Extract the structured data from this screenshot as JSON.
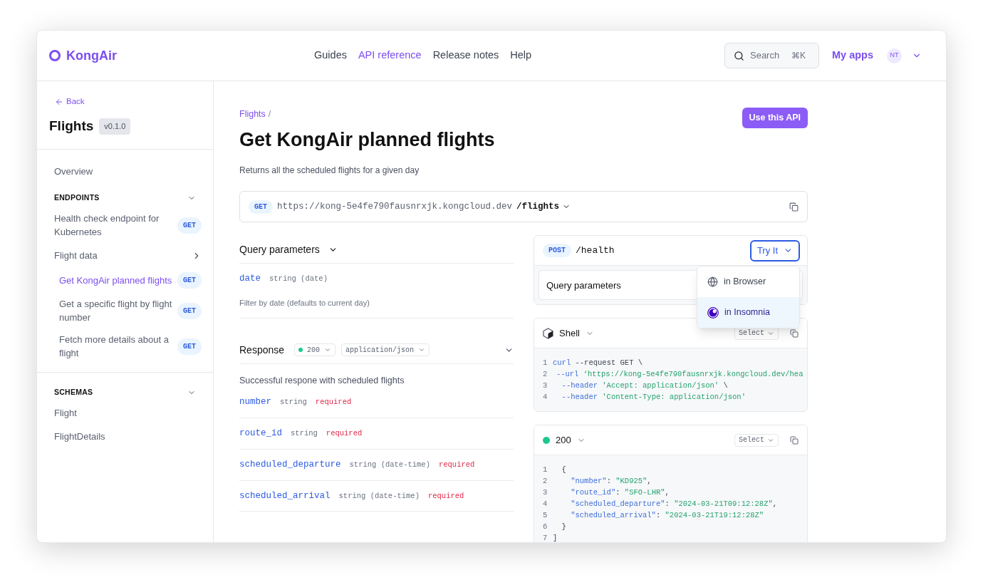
{
  "header": {
    "logo": "KongAir",
    "nav": [
      {
        "label": "Guides",
        "selected": false
      },
      {
        "label": "API reference",
        "selected": true
      },
      {
        "label": "Release notes",
        "selected": false
      },
      {
        "label": "Help",
        "selected": false
      }
    ],
    "search": {
      "placeholder": "Search",
      "shortcut": "⌘K"
    },
    "my_apps": "My apps",
    "avatar": "NT"
  },
  "sidebar": {
    "back": "Back",
    "title": "Flights",
    "version": "v0.1.0",
    "overview": {
      "label": "Overview",
      "selected": false
    },
    "sections": [
      {
        "title": "ENDPOINTS",
        "expanded": true,
        "items": [
          {
            "label": "Health check endpoint for Kubernetes",
            "method": "GET",
            "selected": false
          },
          {
            "label": "Flight data",
            "selected": false,
            "children": [
              {
                "label": "Get KongAir planned flights",
                "method": "GET",
                "selected": true
              },
              {
                "label": "Get a specific flight by flight number",
                "method": "GET",
                "selected": false
              },
              {
                "label": "Fetch more details about a flight",
                "method": "GET",
                "selected": false
              }
            ]
          }
        ]
      },
      {
        "title": "SCHEMAS",
        "expanded": true,
        "items": [
          {
            "label": "Flight",
            "selected": false
          },
          {
            "label": "FlightDetails",
            "selected": false
          }
        ]
      }
    ]
  },
  "main": {
    "breadcrumb": [
      "Flights",
      "/"
    ],
    "title": "Get KongAir planned flights",
    "use_button": "Use this API",
    "description": "Returns all the scheduled flights for a given day",
    "endpoint": {
      "method": "GET",
      "base": "https://kong-5e4fe790fausnrxjk.kongcloud.dev",
      "path": "/flights"
    },
    "query": {
      "title": "Query parameters",
      "expanded": true,
      "params": [
        {
          "name": "date",
          "type": "string (date)",
          "required": false,
          "description": "Filter by date (defaults to current day)"
        }
      ]
    },
    "response": {
      "title": "Response",
      "status": "200",
      "content_type": "application/json",
      "expanded": true,
      "description": "Successful respone with scheduled flights",
      "fields": [
        {
          "name": "number",
          "type": "string",
          "required": true,
          "required_label": "required"
        },
        {
          "name": "route_id",
          "type": "string",
          "required": true,
          "required_label": "required"
        },
        {
          "name": "scheduled_departure",
          "type": "string (date-time)",
          "required": true,
          "required_label": "required"
        },
        {
          "name": "scheduled_arrival",
          "type": "string (date-time)",
          "required": true,
          "required_label": "required"
        }
      ]
    }
  },
  "try_panel": {
    "method": "POST",
    "path": "/health",
    "try_button": "Try It",
    "menu_open": true,
    "query_title": "Query parameters",
    "menu": [
      {
        "label": "in Browser",
        "kind": "globe",
        "selected": false
      },
      {
        "label": "in Insomnia",
        "kind": "insomnia",
        "selected": true
      }
    ],
    "request": {
      "language": "Shell",
      "select": "Select",
      "lines": [
        {
          "number": "1",
          "tokens": [
            {
              "kind": "keyword",
              "text": "curl"
            },
            {
              "kind": "plain",
              "text": " --request GET \\"
            }
          ]
        },
        {
          "number": "2",
          "tokens": [
            {
              "kind": "keyword",
              "text": "  --url"
            },
            {
              "kind": "string",
              "text": " ‘https://kong-5e4fe790fausnrxjk.kongcloud.dev/hea"
            }
          ]
        },
        {
          "number": "3",
          "tokens": [
            {
              "kind": "keyword",
              "text": "  --header"
            },
            {
              "kind": "string",
              "text": " 'Accept: application/json'"
            },
            {
              "kind": "plain",
              "text": " \\"
            }
          ]
        },
        {
          "number": "4",
          "tokens": [
            {
              "kind": "keyword",
              "text": "  --header"
            },
            {
              "kind": "string",
              "text": " 'Content-Type: application/json'"
            }
          ]
        }
      ]
    },
    "response": {
      "status": "200",
      "select": "Select",
      "lines": [
        {
          "number": "1",
          "tokens": [
            {
              "kind": "plain",
              "text": "  {"
            }
          ]
        },
        {
          "number": "2",
          "tokens": [
            {
              "kind": "keyword",
              "text": "    \"number\""
            },
            {
              "kind": "plain",
              "text": ": "
            },
            {
              "kind": "string",
              "text": "\"KD925\""
            },
            {
              "kind": "plain",
              "text": ","
            }
          ]
        },
        {
          "number": "3",
          "tokens": [
            {
              "kind": "keyword",
              "text": "    \"route_id\""
            },
            {
              "kind": "plain",
              "text": ": "
            },
            {
              "kind": "string",
              "text": "\"SFO-LHR\""
            },
            {
              "kind": "plain",
              "text": ","
            }
          ]
        },
        {
          "number": "4",
          "tokens": [
            {
              "kind": "keyword",
              "text": "    \"scheduled_departure\""
            },
            {
              "kind": "plain",
              "text": ": "
            },
            {
              "kind": "string",
              "text": "\"2024-03-21T09:12:28Z\""
            },
            {
              "kind": "plain",
              "text": ","
            }
          ]
        },
        {
          "number": "5",
          "tokens": [
            {
              "kind": "keyword",
              "text": "    \"scheduled_arrival\""
            },
            {
              "kind": "plain",
              "text": ": "
            },
            {
              "kind": "string",
              "text": "\"2024-03-21T19:12:28Z\""
            }
          ]
        },
        {
          "number": "6",
          "tokens": [
            {
              "kind": "plain",
              "text": "  }"
            }
          ]
        },
        {
          "number": "7",
          "tokens": [
            {
              "kind": "plain",
              "text": "]"
            }
          ]
        }
      ]
    }
  }
}
